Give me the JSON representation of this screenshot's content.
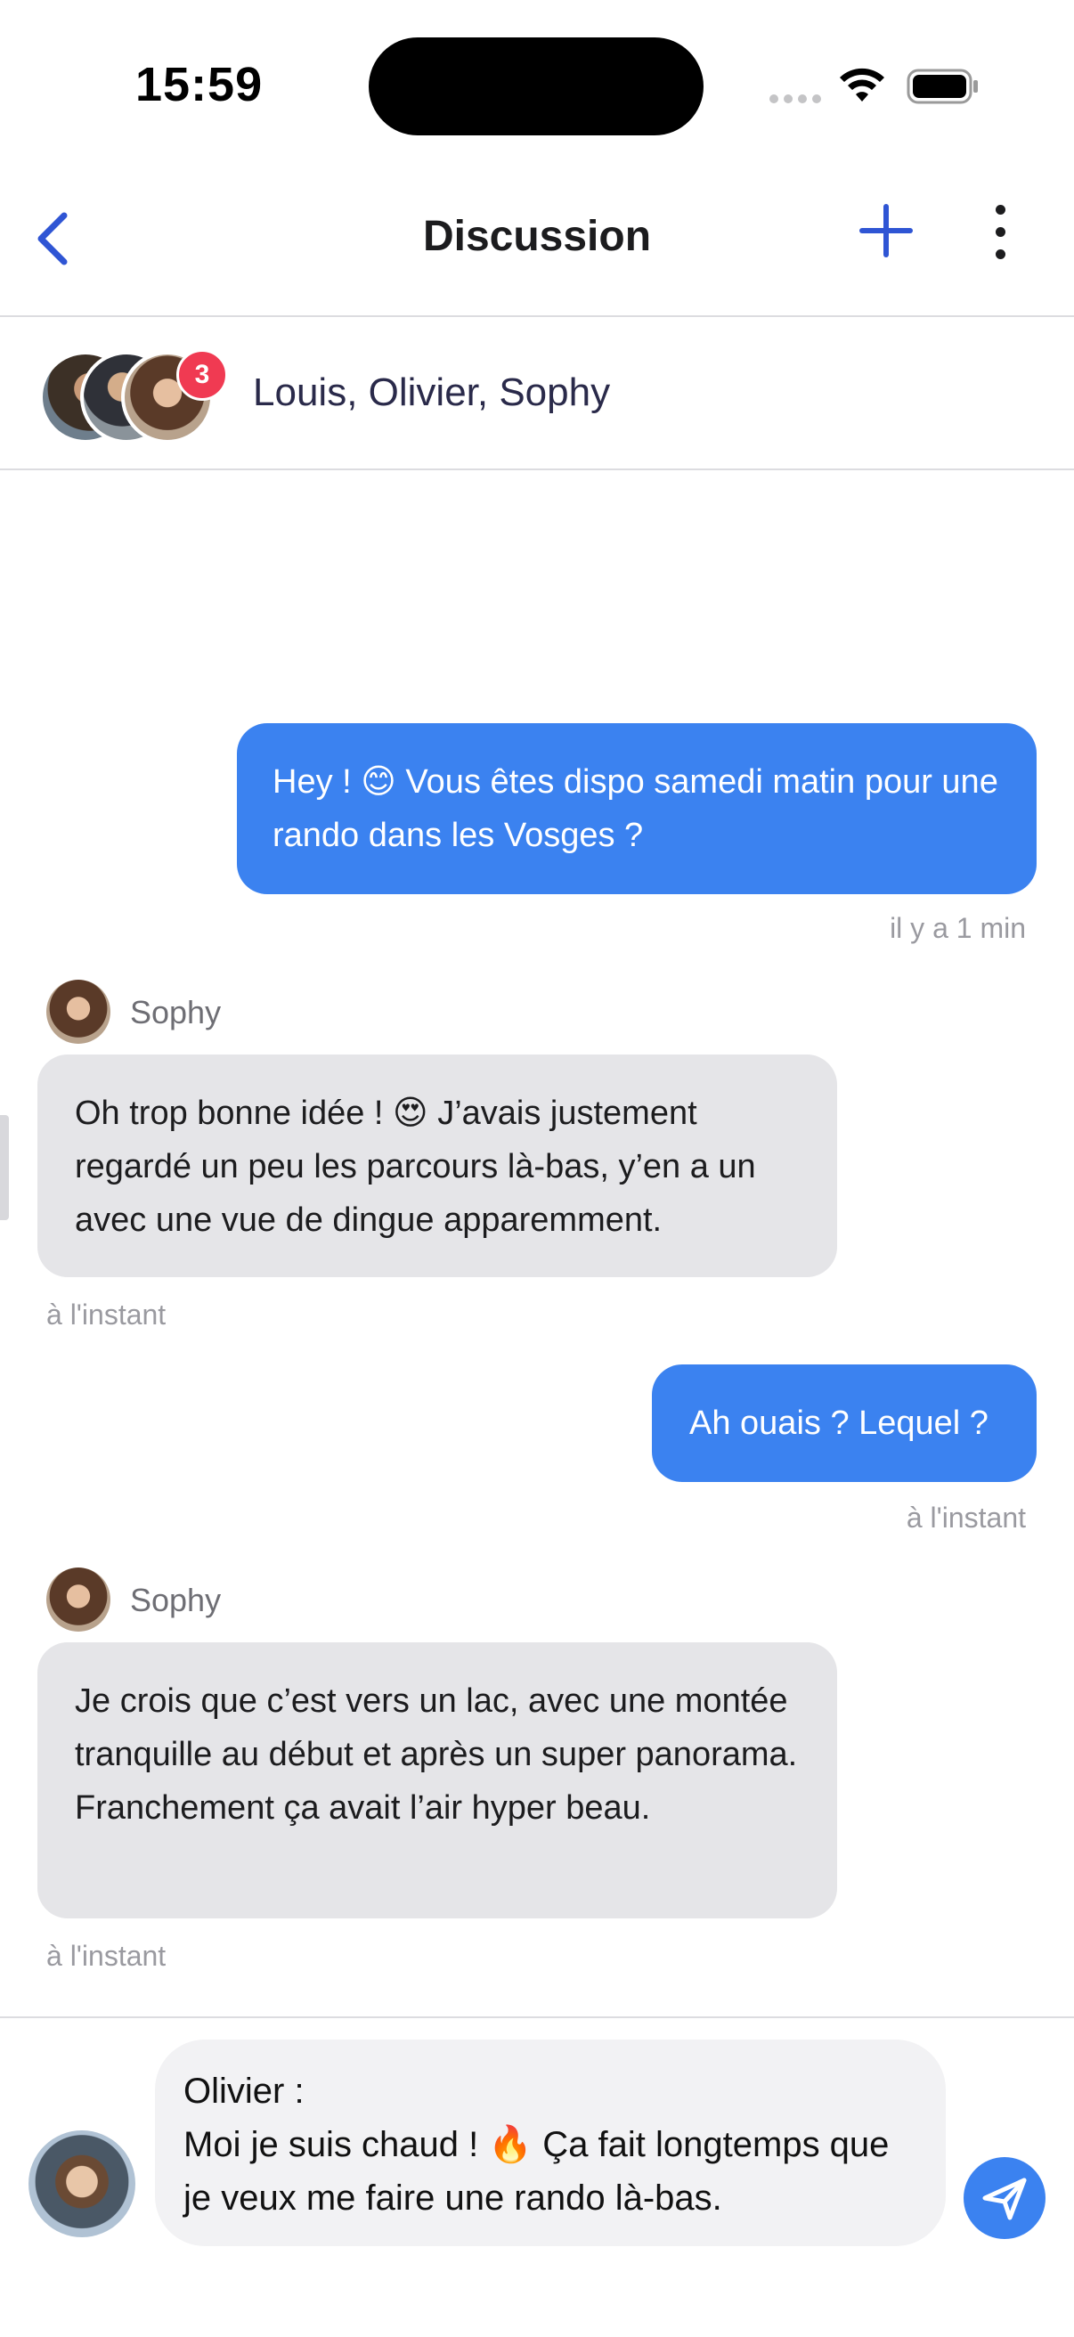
{
  "status_bar": {
    "time": "15:59"
  },
  "header": {
    "title": "Discussion"
  },
  "participants": {
    "names": "Louis, Olivier, Sophy",
    "badge_count": "3"
  },
  "messages": [
    {
      "direction": "outgoing",
      "text": "Hey ! 😊 Vous êtes dispo samedi matin pour une rando dans les Vosges ?",
      "time": "il y a 1 min"
    },
    {
      "direction": "incoming",
      "sender": "Sophy",
      "text": "Oh trop bonne idée ! 😍 J’avais justement regardé un peu les parcours là-bas, y’en a un avec une vue de dingue apparemment.",
      "time": "à l'instant"
    },
    {
      "direction": "outgoing",
      "text": "Ah ouais ? Lequel ?",
      "time": "à l'instant"
    },
    {
      "direction": "incoming",
      "sender": "Sophy",
      "text": "Je crois que c’est vers un lac, avec une montée tranquille au début et après un super panorama. Franchement ça avait l’air hyper beau.",
      "time": "à l'instant"
    }
  ],
  "composer": {
    "label": "Olivier :",
    "text": "Moi je suis chaud ! 🔥 Ça fait longtemps que je veux me faire une rando là-bas."
  },
  "colors": {
    "accent": "#3b82f0",
    "badge": "#f03a52",
    "incoming_bubble": "#e5e5e8"
  }
}
